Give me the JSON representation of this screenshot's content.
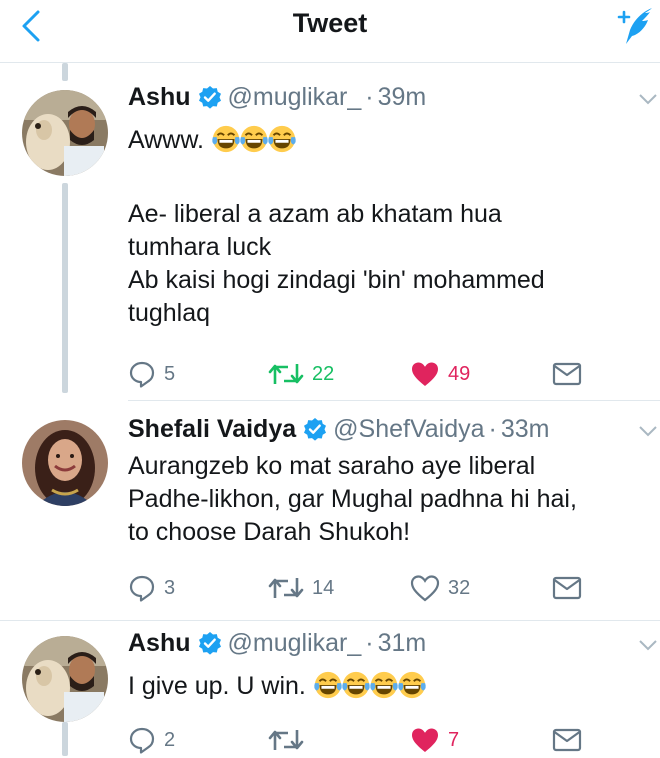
{
  "header": {
    "title": "Tweet"
  },
  "colors": {
    "accent": "#1da1f2",
    "retweeted": "#17bf63",
    "liked": "#e0245e",
    "muted": "#657786"
  },
  "tweets": [
    {
      "name": "Ashu",
      "verified": true,
      "handle": "@muglikar_",
      "time": "39m",
      "text_line1": "Awww.",
      "emoji_count": 3,
      "text_body": "Ae- liberal a azam ab khatam hua\ntumhara luck\nAb kaisi hogi zindagi 'bin' mohammed\ntughlaq",
      "replies": "5",
      "retweets": "22",
      "likes": "49",
      "retweeted": true,
      "liked": true
    },
    {
      "name": "Shefali Vaidya",
      "verified": true,
      "handle": "@ShefVaidya",
      "time": "33m",
      "text_body": "Aurangzeb ko mat saraho aye liberal\nPadhe-likhon, gar Mughal padhna hi hai,\nto choose Darah Shukoh!",
      "replies": "3",
      "retweets": "14",
      "likes": "32",
      "retweeted": false,
      "liked": false
    },
    {
      "name": "Ashu",
      "verified": true,
      "handle": "@muglikar_",
      "time": "31m",
      "text_line1": "I give up. U win.",
      "emoji_count": 4,
      "replies": "2",
      "retweets": "",
      "likes": "7",
      "retweeted": false,
      "liked": true
    }
  ]
}
